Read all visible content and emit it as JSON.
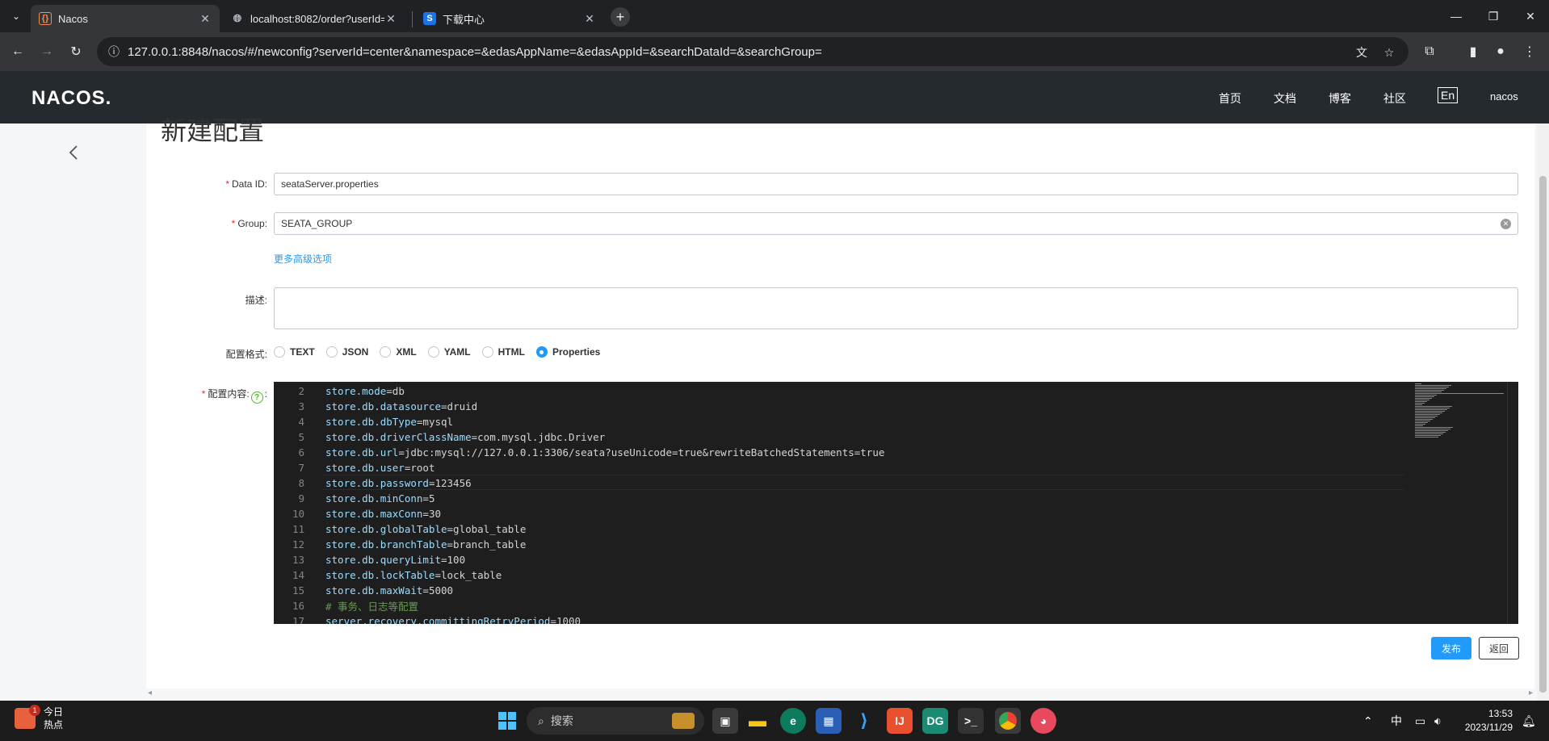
{
  "browser": {
    "tabs": [
      {
        "title": "Nacos",
        "active": true
      },
      {
        "title": "localhost:8082/order?userId="
      },
      {
        "title": "下载中心"
      }
    ],
    "url": "127.0.0.1:8848/nacos/#/newconfig?serverId=center&namespace=&edasAppName=&edasAppId=&searchDataId=&searchGroup="
  },
  "header": {
    "logo": "NACOS.",
    "nav": [
      "首页",
      "文档",
      "博客",
      "社区"
    ],
    "lang": "En",
    "user": "nacos"
  },
  "form": {
    "title": "新建配置",
    "data_id_label": "Data ID:",
    "data_id_value": "seataServer.properties",
    "group_label": "Group:",
    "group_value": "SEATA_GROUP",
    "advanced_link": "更多高级选项",
    "desc_label": "描述:",
    "format_label": "配置格式:",
    "formats": [
      "TEXT",
      "JSON",
      "XML",
      "YAML",
      "HTML",
      "Properties"
    ],
    "selected_format": "Properties",
    "content_label": "配置内容:",
    "content_colon": ":",
    "help_glyph": "?",
    "required_mark": "*",
    "publish_button": "发布",
    "back_button": "返回"
  },
  "editor_lines": [
    {
      "n": "2",
      "k": "store.mode",
      "v": "db"
    },
    {
      "n": "3",
      "k": "store.db.datasource",
      "v": "druid"
    },
    {
      "n": "4",
      "k": "store.db.dbType",
      "v": "mysql"
    },
    {
      "n": "5",
      "k": "store.db.driverClassName",
      "v": "com.mysql.jdbc.Driver"
    },
    {
      "n": "6",
      "k": "store.db.url",
      "v": "jdbc:mysql://127.0.0.1:3306/seata?useUnicode=true&rewriteBatchedStatements=true"
    },
    {
      "n": "7",
      "k": "store.db.user",
      "v": "root"
    },
    {
      "n": "8",
      "k": "store.db.password",
      "v": "123456"
    },
    {
      "n": "9",
      "k": "store.db.minConn",
      "v": "5"
    },
    {
      "n": "10",
      "k": "store.db.maxConn",
      "v": "30"
    },
    {
      "n": "11",
      "k": "store.db.globalTable",
      "v": "global_table"
    },
    {
      "n": "12",
      "k": "store.db.branchTable",
      "v": "branch_table"
    },
    {
      "n": "13",
      "k": "store.db.queryLimit",
      "v": "100"
    },
    {
      "n": "14",
      "k": "store.db.lockTable",
      "v": "lock_table"
    },
    {
      "n": "15",
      "k": "store.db.maxWait",
      "v": "5000"
    },
    {
      "n": "16",
      "comment": "# 事务、日志等配置"
    },
    {
      "n": "17",
      "k": "server.recovery.committingRetryPeriod",
      "v": "1000"
    }
  ],
  "taskbar": {
    "weather_title": "今日",
    "weather_sub": "热点",
    "badge": "1",
    "search": "搜索",
    "ime": "中",
    "time": "13:53",
    "date": "2023/11/29"
  }
}
